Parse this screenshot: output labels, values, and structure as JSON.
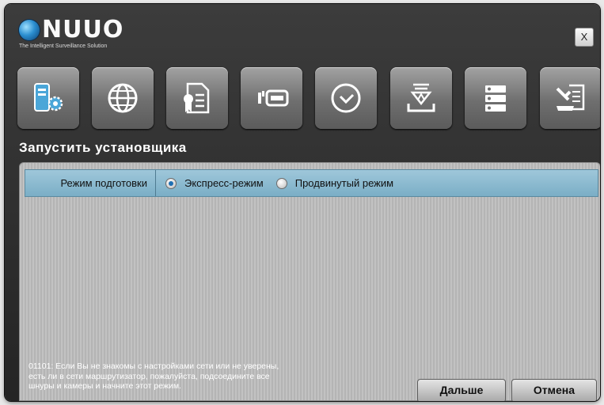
{
  "brand": {
    "name": "NUUO",
    "tagline": "The Intelligent Surveillance Solution"
  },
  "window": {
    "close_label": "X"
  },
  "toolbar": {
    "icons": [
      "system-settings-icon",
      "network-globe-icon",
      "certificate-icon",
      "storage-drive-icon",
      "clock-icon",
      "download-install-icon",
      "server-list-icon",
      "tools-document-icon"
    ]
  },
  "section_title": "Запустить установщика",
  "setup_mode": {
    "label": "Режим подготовки",
    "options": [
      {
        "label": "Экспресс-режим",
        "selected": true
      },
      {
        "label": "Продвинутый режим",
        "selected": false
      }
    ]
  },
  "info_text": {
    "line1": "01101: Если Вы не знакомы с настройками сети или не уверены,",
    "line2": "есть ли в сети маршрутизатор, пожалуйста, подсоедините все",
    "line3": "шнуры и камеры и начните этот режим."
  },
  "buttons": {
    "next": "Дальше",
    "cancel": "Отмена"
  },
  "colors": {
    "accent": "#7aaec6",
    "selected_radio": "#1f6fb3"
  }
}
